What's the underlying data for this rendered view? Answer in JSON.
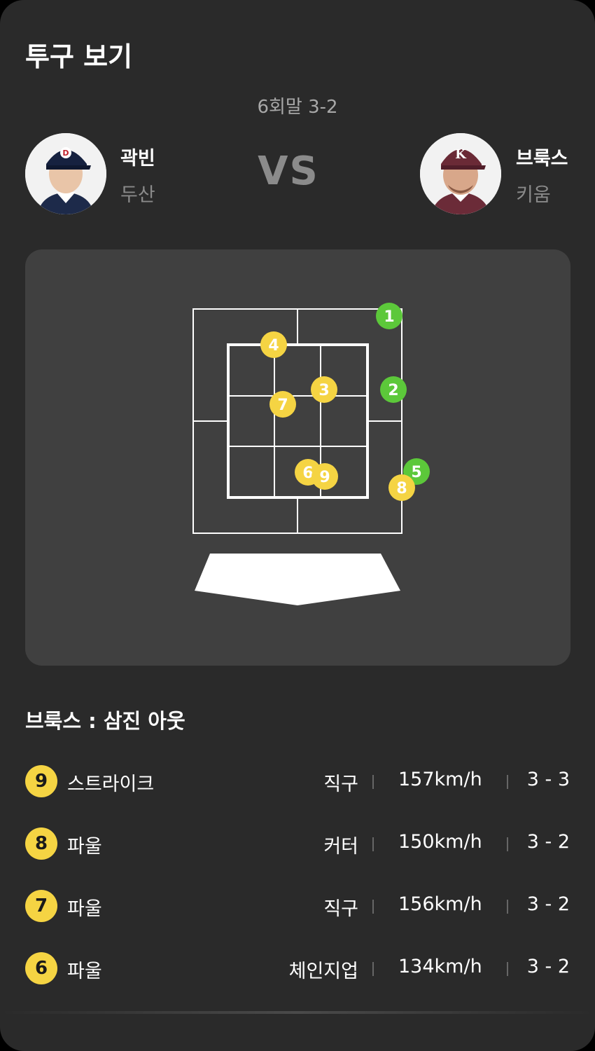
{
  "header": {
    "title": "투구 보기"
  },
  "game": {
    "inning_score": "6회말 3-2"
  },
  "pitcher": {
    "name": "곽빈",
    "team": "두산"
  },
  "batter": {
    "name": "브룩스",
    "team": "키움"
  },
  "vs_label": "VS",
  "pitch_zone": {
    "pitches": [
      {
        "n": "1",
        "type": "ball"
      },
      {
        "n": "2",
        "type": "ball"
      },
      {
        "n": "3",
        "type": "strike"
      },
      {
        "n": "4",
        "type": "strike"
      },
      {
        "n": "5",
        "type": "ball"
      },
      {
        "n": "6",
        "type": "strike"
      },
      {
        "n": "7",
        "type": "strike"
      },
      {
        "n": "8",
        "type": "strike"
      },
      {
        "n": "9",
        "type": "strike"
      }
    ],
    "colors": {
      "ball": "#5cc83a",
      "strike": "#f5d443"
    }
  },
  "at_bat_result": "브룩스 : 삼진 아웃",
  "pitch_log": [
    {
      "num": "9",
      "event": "스트라이크",
      "pitch_type": "직구",
      "speed": "157km/h",
      "count": "3 - 3"
    },
    {
      "num": "8",
      "event": "파울",
      "pitch_type": "커터",
      "speed": "150km/h",
      "count": "3 - 2"
    },
    {
      "num": "7",
      "event": "파울",
      "pitch_type": "직구",
      "speed": "156km/h",
      "count": "3 - 2"
    },
    {
      "num": "6",
      "event": "파울",
      "pitch_type": "체인지업",
      "speed": "134km/h",
      "count": "3 - 2"
    }
  ]
}
